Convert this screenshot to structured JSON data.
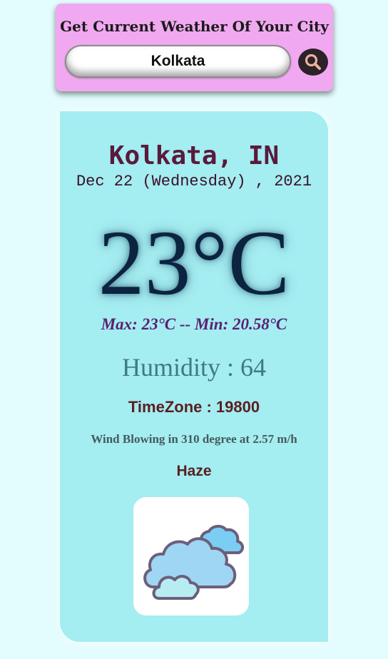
{
  "search": {
    "heading": "Get Current Weather Of Your City",
    "value": "Kolkata",
    "button_icon": "search-icon"
  },
  "weather": {
    "city": "Kolkata, IN",
    "date": "Dec 22 (Wednesday) , 2021",
    "temperature": "23°C",
    "max_min": "Max: 23°C -- Min: 20.58°C",
    "humidity": "Humidity : 64",
    "timezone": "TimeZone : 19800",
    "wind": "Wind Blowing in 310 degree at 2.57 m/h",
    "condition": "Haze",
    "condition_icon": "cloudy-icon"
  },
  "colors": {
    "page_background": "#e3fcfd",
    "search_card": "#f0a9f0",
    "weather_card": "#a4edf1",
    "search_button": "#2d2228"
  }
}
